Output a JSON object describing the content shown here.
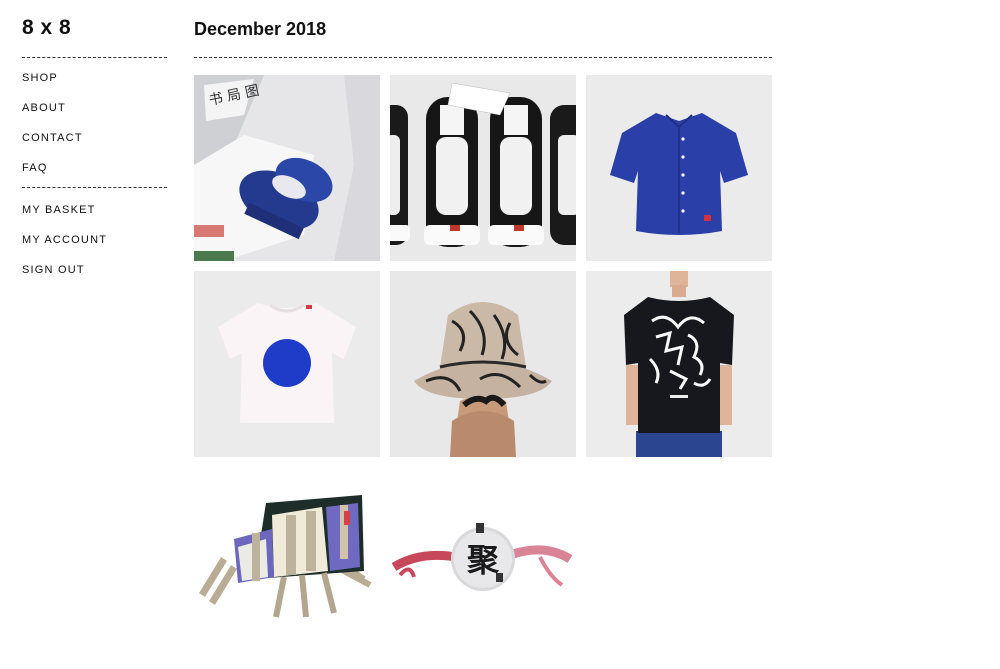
{
  "brand": {
    "logo": "8 x 8"
  },
  "nav": {
    "primary": [
      {
        "label": "SHOP"
      },
      {
        "label": "ABOUT"
      },
      {
        "label": "CONTACT"
      },
      {
        "label": "FAQ"
      }
    ],
    "account": [
      {
        "label": "MY BASKET"
      },
      {
        "label": "MY ACCOUNT"
      },
      {
        "label": "SIGN OUT"
      }
    ]
  },
  "main": {
    "title": "December 2018",
    "products": [
      {
        "name": "sneakers in packaging",
        "image": "blue-sneakers"
      },
      {
        "name": "black sneakers",
        "image": "black-sneakers"
      },
      {
        "name": "blue shirt",
        "image": "blue-shirt"
      },
      {
        "name": "white t-shirt with blue dot",
        "image": "dot-tshirt"
      },
      {
        "name": "bucket hat",
        "image": "bucket-hat"
      },
      {
        "name": "black graphic t-shirt",
        "image": "graphic-tshirt"
      },
      {
        "name": "utility waist bag",
        "image": "waist-bag"
      },
      {
        "name": "round character bag",
        "image": "round-bag"
      }
    ]
  },
  "colors": {
    "text": "#111111",
    "tile_bg": "#ececec",
    "accent_blue": "#2a3fa8"
  }
}
